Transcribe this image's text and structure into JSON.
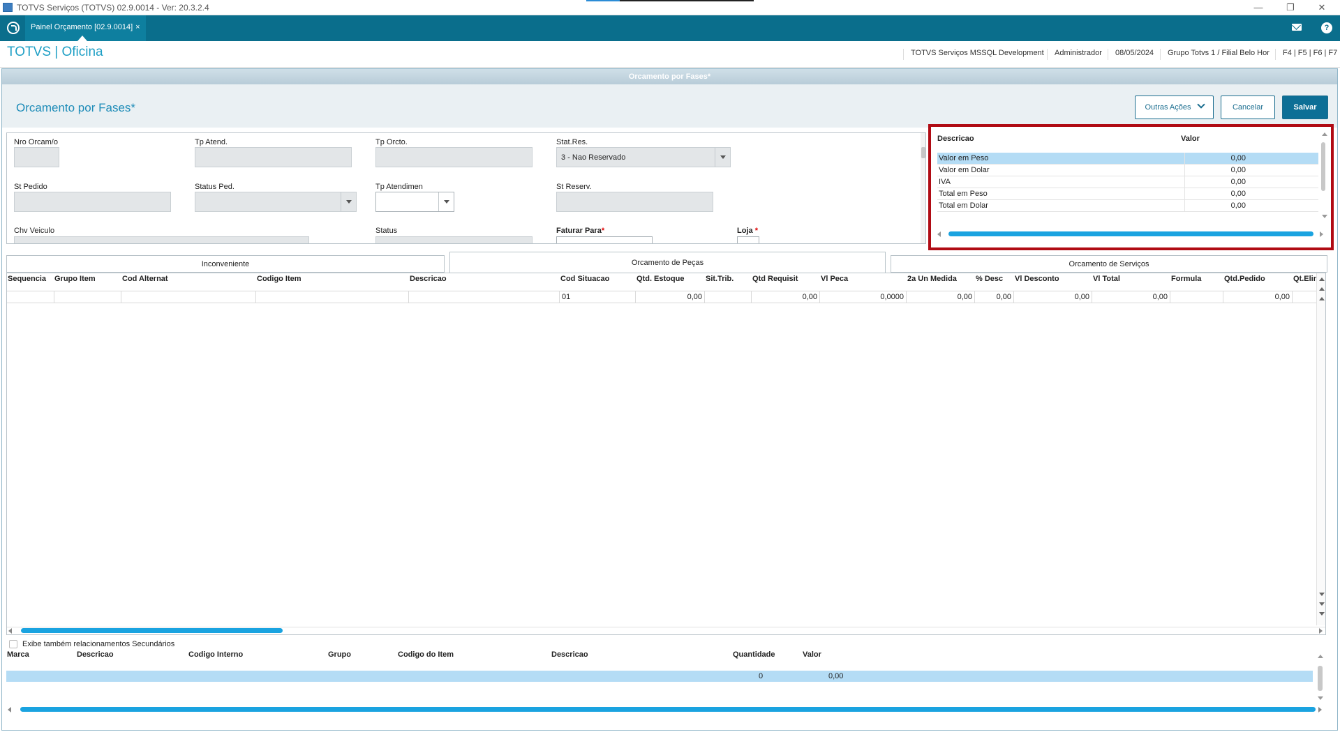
{
  "window": {
    "title": "TOTVS Serviços (TOTVS) 02.9.0014 - Ver: 20.3.2.4",
    "controls": [
      "—",
      "❐",
      "✕"
    ]
  },
  "tabbar": {
    "tab_label": "Painel Orçamento [02.9.0014]",
    "tab_close": "×",
    "help_label": "?"
  },
  "header": {
    "brand": "TOTVS | Oficina",
    "environment": "TOTVS Serviços MSSQL Development",
    "user": "Administrador",
    "date": "08/05/2024",
    "branch": "Grupo Totvs 1 / Filial Belo Hor",
    "shortcuts": "F4 | F5 | F6 | F7"
  },
  "screen": {
    "frame_title": "Orcamento por Fases*",
    "page_title": "Orcamento por Fases*",
    "buttons": {
      "other_actions": "Outras Ações",
      "cancel": "Cancelar",
      "save": "Salvar"
    }
  },
  "form": {
    "nro_orcam_label": "Nro Orcam/o",
    "tp_atend_label": "Tp Atend.",
    "tp_orcto_label": "Tp Orcto.",
    "stat_res_label": "Stat.Res.",
    "stat_res_value": "3 - Nao Reservado",
    "st_pedido_label": "St Pedido",
    "status_ped_label": "Status Ped.",
    "tp_atendimen_label": "Tp Atendimen",
    "st_reserv_label": "St Reserv.",
    "chv_veiculo_label": "Chv Veiculo",
    "status_label": "Status",
    "faturar_para_label": "Faturar Para",
    "loja_label": "Loja",
    "required_mark": "*"
  },
  "totals": {
    "col_descricao": "Descricao",
    "col_valor": "Valor",
    "rows": [
      {
        "descricao": "Valor em Peso",
        "valor": "0,00"
      },
      {
        "descricao": "Valor em Dolar",
        "valor": "0,00"
      },
      {
        "descricao": "IVA",
        "valor": "0,00"
      },
      {
        "descricao": "Total em Peso",
        "valor": "0,00"
      },
      {
        "descricao": "Total em Dolar",
        "valor": "0,00"
      }
    ]
  },
  "tabs": {
    "inconveniente": "Inconveniente",
    "orcamento_pecas": "Orcamento de Peças",
    "orcamento_servicos": "Orcamento de Serviços"
  },
  "parts_grid": {
    "columns": [
      "Sequencia",
      "Grupo Item",
      "Cod Alternat",
      "Codigo Item",
      "Descricao",
      "Cod Situacao",
      "Qtd. Estoque",
      "Sit.Trib.",
      "Qtd Requisit",
      "Vl Peca",
      "2a Un Medida",
      "% Desc",
      "Vl Desconto",
      "Vl Total",
      "Formula",
      "Qtd.Pedido",
      "Qt.Elim"
    ],
    "row": [
      "",
      "",
      "",
      "",
      "",
      "01",
      "0,00",
      "",
      "0,00",
      "0,0000",
      "0,00",
      "0,00",
      "0,00",
      "0,00",
      "",
      "0,00",
      ""
    ]
  },
  "secondary": {
    "checkbox_label": "Exibe também relacionamentos Secundários",
    "columns": [
      "Marca",
      "Descricao",
      "Codigo Interno",
      "Grupo",
      "Codigo do Item",
      "Descricao",
      "Quantidade",
      "Valor"
    ],
    "row": {
      "quantidade": "0",
      "valor": "0,00"
    }
  },
  "colors": {
    "accent": "#0a6e8c",
    "brand": "#1e9fc5",
    "highlight_border": "#b00b14",
    "selection": "#b4dcf5"
  }
}
